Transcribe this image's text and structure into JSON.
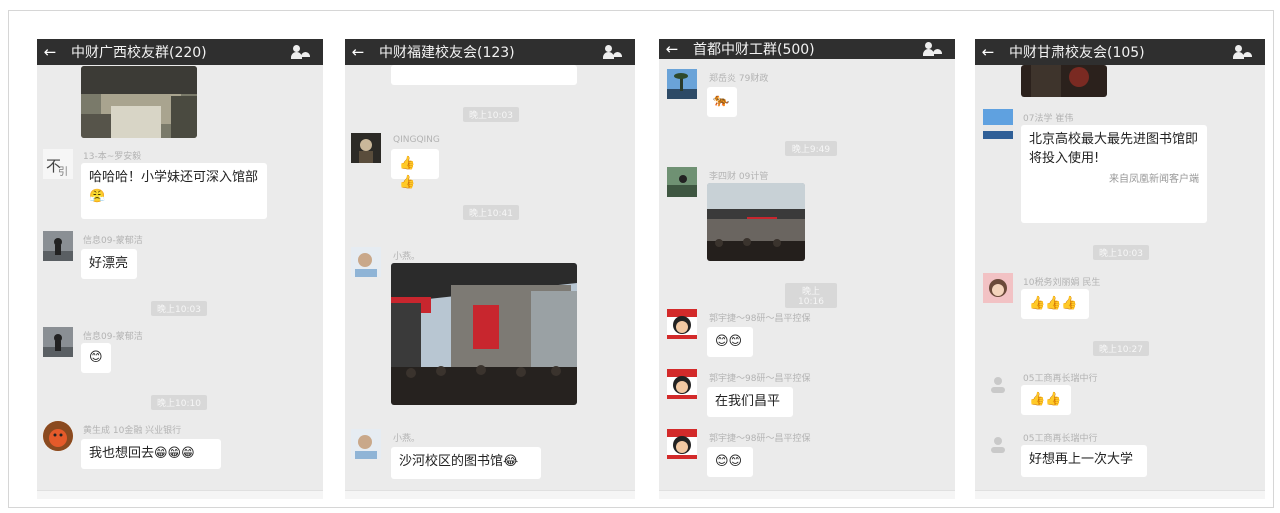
{
  "panels": [
    {
      "title": "中财广西校友群(220)",
      "messages": [
        {
          "name": "13-本~罗安毅",
          "text": "哈哈哈！小学妹还可深入馆部",
          "emoji": "😤"
        },
        {
          "name": "信息09-蒙郁洁",
          "text": "好漂亮"
        },
        {
          "system": "晚上10:03"
        },
        {
          "name": "信息09-蒙郁洁",
          "text": "😊"
        },
        {
          "system": "晚上10:10"
        },
        {
          "name": "黄生成 10金融 兴业银行",
          "text": "我也想回去😁😁😁"
        }
      ]
    },
    {
      "title": "中财福建校友会(123)",
      "messages": [
        {
          "system": "晚上10:03"
        },
        {
          "name": "QINGQING",
          "text": "👍👍"
        },
        {
          "system": "晚上10:41"
        },
        {
          "name": "小燕。",
          "text": ""
        },
        {
          "name": "小燕。",
          "text": "沙河校区的图书馆😂"
        }
      ]
    },
    {
      "title": "首都中财工群(500)",
      "messages": [
        {
          "name": "郑岳炎 79财政",
          "text": "🐅"
        },
        {
          "system": "晚上9:49"
        },
        {
          "name": "李四财 09计管",
          "text": ""
        },
        {
          "system": "晚上10:16"
        },
        {
          "name": "郭宇捷～98研～昌平控保",
          "text": "😊😊"
        },
        {
          "name": "郭宇捷～98研～昌平控保",
          "text": "在我们昌平"
        },
        {
          "name": "郭宇捷～98研～昌平控保",
          "text": "😊😊"
        }
      ]
    },
    {
      "title": "中财甘肃校友会(105)",
      "messages": [
        {
          "name": "07法学 崔伟",
          "text": "北京高校最大最先进图书馆即将投入使用!",
          "source": "来自凤凰新闻客户端"
        },
        {
          "system": "晚上10:03"
        },
        {
          "name": "10税务刘丽娟 民生",
          "text": "👍👍👍"
        },
        {
          "system": "晚上10:27"
        },
        {
          "name": "05工商再长瑞中行",
          "text": "👍👍"
        },
        {
          "name": "05工商再长瑞中行",
          "text": "好想再上一次大学"
        }
      ]
    }
  ],
  "icons": {
    "back": "back-arrow-icon",
    "group": "group-members-icon"
  }
}
